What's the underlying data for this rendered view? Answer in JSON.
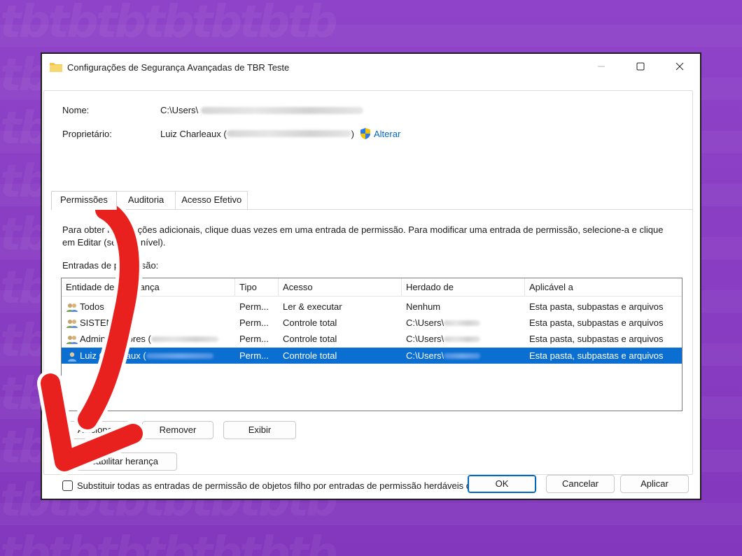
{
  "window": {
    "title": "Configurações de Segurança Avançadas de TBR Teste",
    "min_symbol": "—",
    "max_symbol": "☐",
    "close_symbol": "✕"
  },
  "fields": {
    "name_label": "Nome:",
    "name_value": "C:\\Users\\",
    "owner_label": "Proprietário:",
    "owner_value": "Luiz Charleaux (",
    "owner_value_end": ")",
    "change_link": "Alterar"
  },
  "tabs": [
    "Permissões",
    "Auditoria",
    "Acesso Efetivo"
  ],
  "info_text": "Para obter informações adicionais, clique duas vezes em uma entrada de permissão. Para modificar uma entrada de permissão, selecione-a e clique em Editar (se disponível).",
  "entries_label": "Entradas de permissão:",
  "table": {
    "columns": [
      "Entidade de segurança",
      "Tipo",
      "Acesso",
      "Herdado de",
      "Aplicável a"
    ],
    "rows": [
      {
        "principal": "Todos",
        "type": "Perm...",
        "access": "Ler & executar",
        "inherited": "Nenhum",
        "applies": "Esta pasta, subpastas e arquivos",
        "icon": "group-users-icon"
      },
      {
        "principal": "SISTEMA",
        "type": "Perm...",
        "access": "Controle total",
        "inherited": "C:\\Users\\",
        "applies": "Esta pasta, subpastas e arquivos",
        "icon": "group-users-icon"
      },
      {
        "principal": "Administradores (",
        "type": "Perm...",
        "access": "Controle total",
        "inherited": "C:\\Users\\",
        "applies": "Esta pasta, subpastas e arquivos",
        "icon": "group-users-icon"
      },
      {
        "principal": "Luiz Charleaux (",
        "type": "Perm...",
        "access": "Controle total",
        "inherited": "C:\\Users\\",
        "applies": "Esta pasta, subpastas e arquivos",
        "icon": "single-user-icon"
      }
    ]
  },
  "buttons": {
    "add": "Adicionar",
    "remove": "Remover",
    "view": "Exibir",
    "inheritance": "Desabilitar herança",
    "ok": "OK",
    "cancel": "Cancelar",
    "apply": "Aplicar"
  },
  "checkbox_label": "Substituir todas as entradas de permissão de objetos filho por entradas de permissão herdáveis desse objeto",
  "checkbox_checked": false,
  "background_watermark": "tbtbtbtbtbtbtb",
  "colors": {
    "background": "#8a3fc2",
    "selection": "#0a6fd1",
    "link": "#0067c0",
    "arrow": "#e8211f"
  }
}
